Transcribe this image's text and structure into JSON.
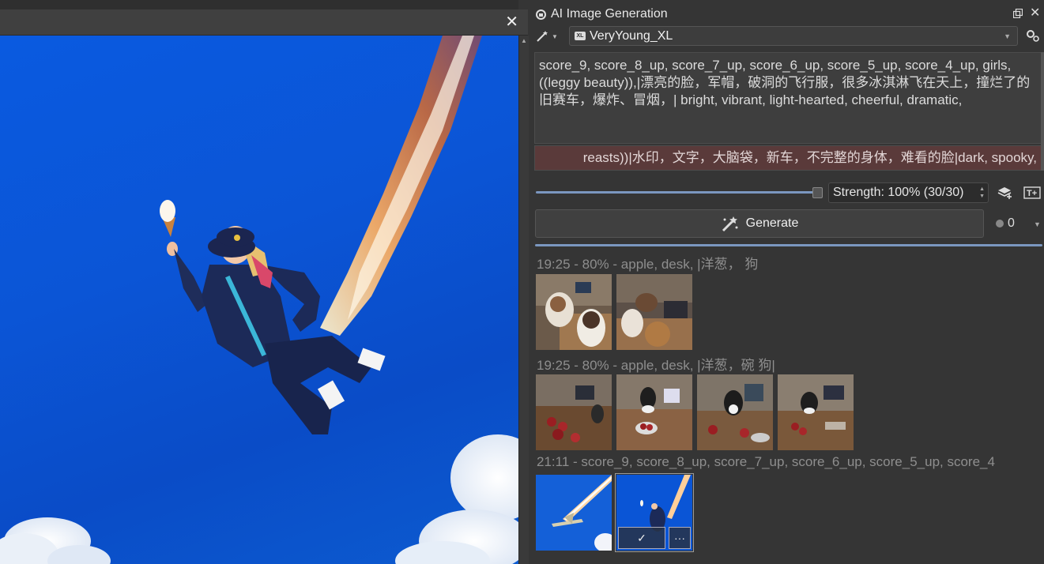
{
  "canvas": {
    "close_glyph": "✕"
  },
  "dock": {
    "title": "AI Image Generation",
    "close_glyph": "✕",
    "model": {
      "badge": "XL",
      "name": "VeryYoung_XL"
    },
    "prompt": "score_9, score_8_up, score_7_up, score_6_up, score_5_up, score_4_up, girls, ((leggy beauty)),|漂亮的脸，军帽，破洞的飞行服，很多冰淇淋飞在天上，撞烂了的旧赛车，爆炸、冒烟，| bright, vibrant, light-hearted, cheerful, dramatic,",
    "negative_prompt": "reasts))|水印，文字，大脑袋，新车，不完整的身体，难看的脸|dark, spooky,",
    "strength": {
      "text": "Strength: 100% (30/30)",
      "value_fraction": 1.0
    },
    "generate_label": "Generate",
    "queue_count": "0",
    "progress_fraction": 1.0,
    "history": [
      {
        "label": "19:25 - 80% - apple, desk, |洋葱，  狗",
        "thumbs": [
          "dogs-desk-1",
          "dogs-desk-2"
        ]
      },
      {
        "label": "19:25 - 80% - apple, desk, |洋葱，碗  狗|",
        "thumbs": [
          "dog-apples-1",
          "dog-apples-2",
          "dog-apples-3",
          "dog-apples-4"
        ]
      },
      {
        "label": "21:11 - score_9, score_8_up, score_7_up, score_6_up, score_5_up, score_4",
        "thumbs": [
          "jet-sky",
          "girl-flying"
        ]
      }
    ],
    "apply_glyph": "✓",
    "more_glyph": "···"
  },
  "colors": {
    "accent": "#7b97c0",
    "sky": "#0a55d6",
    "negative_bg": "#5a3a3a"
  },
  "icons": [
    "close-icon",
    "lock-icon",
    "float-icon",
    "magic-wand-icon",
    "settings-icon",
    "layers-icon",
    "text-icon",
    "generate-icon"
  ]
}
